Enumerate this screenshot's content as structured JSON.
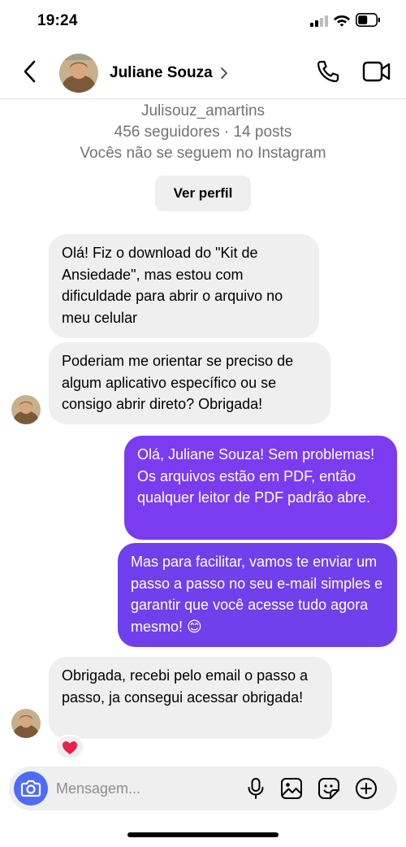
{
  "status_bar": {
    "time": "19:24",
    "icons": [
      "signal-icon",
      "wifi-icon",
      "battery-icon"
    ]
  },
  "header": {
    "contact_name": "Juliane Souza",
    "icons": [
      "back-icon",
      "chevron-right-icon",
      "phone-icon",
      "video-icon"
    ]
  },
  "profile": {
    "username": "Julisouz_amartins",
    "stats": "456 seguidores · 14 posts",
    "follow_status": "Vocês não se seguem no Instagram",
    "view_profile_label": "Ver perfil"
  },
  "messages": [
    {
      "direction": "incoming",
      "text": "Olá! Fiz o download do \"Kit de Ansiedade\", mas estou com dificuldade para abrir o arquivo no meu celular"
    },
    {
      "direction": "incoming",
      "text": "Poderiam me orientar se preciso de algum aplicativo específico ou se consigo abrir direto? Obrigada!"
    },
    {
      "direction": "outgoing",
      "text": "Olá, Juliane Souza! Sem problemas! Os arquivos estão em PDF, então qualquer leitor de PDF padrão abre."
    },
    {
      "direction": "outgoing",
      "text": "Mas para facilitar, vamos te enviar um passo a passo no seu e-mail simples e garantir que você acesse tudo agora mesmo! 😊"
    },
    {
      "direction": "incoming",
      "text": "Obrigada, recebi pelo email o passo a passo, ja consegui acessar obrigada!",
      "reaction": "❤️"
    }
  ],
  "composer": {
    "placeholder": "Mensagem...",
    "icons": [
      "camera-icon",
      "microphone-icon",
      "gallery-icon",
      "sticker-icon",
      "add-icon"
    ]
  },
  "colors": {
    "outgoing_bubble": "#7b3cf0",
    "incoming_bubble": "#efefef",
    "camera_button": "#4f6cf7",
    "muted_text": "#737373"
  }
}
